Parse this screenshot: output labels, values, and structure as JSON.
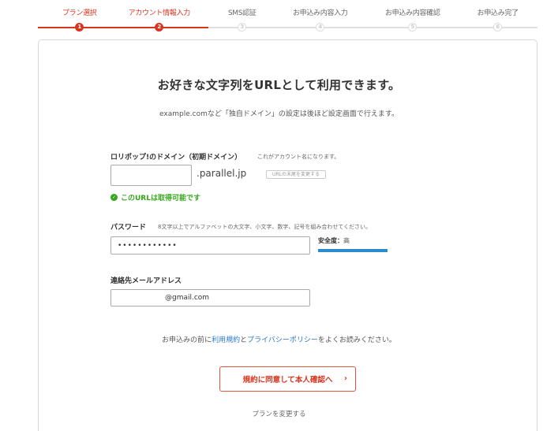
{
  "steps": [
    {
      "label": "プラン選択",
      "num": "1",
      "state": "active"
    },
    {
      "label": "アカウント情報入力",
      "num": "2",
      "state": "active"
    },
    {
      "label": "SMS認証",
      "num": "3",
      "state": "inactive"
    },
    {
      "label": "お申込み内容入力",
      "num": "4",
      "state": "inactive"
    },
    {
      "label": "お申込み内容確認",
      "num": "5",
      "state": "inactive"
    },
    {
      "label": "お申込み完了",
      "num": "6",
      "state": "inactive"
    }
  ],
  "headline": "お好きな文字列をURLとして利用できます。",
  "subline": "example.comなど「独自ドメイン」の設定は後ほど設定画面で行えます。",
  "domain": {
    "label": "ロリポップ!のドメイン（初期ドメイン）",
    "note": "これがアカウント名になります。",
    "value": "",
    "suffix": ".parallel.jp",
    "change_button": "URLの末尾を変更する",
    "availability_msg": "このURLは取得可能です"
  },
  "password": {
    "label": "パスワード",
    "note": "8文字以上でアルファベットの大文字、小文字、数字、記号を組み合わせてください。",
    "value": "••••••••••••",
    "strength_label": "安全度：",
    "strength_level": "高",
    "strength_fraction": 1.0
  },
  "email": {
    "label": "連絡先メールアドレス",
    "value": "@gmail.com"
  },
  "terms": {
    "prefix": "お申込みの前に",
    "link1": "利用規約",
    "middle": "と",
    "link2": "プライバシーポリシー",
    "suffix": "をよくお読みください。"
  },
  "submit_label": "規約に同意して本人確認へ",
  "change_plan_label": "プランを変更する",
  "colors": {
    "accent": "#d9341e",
    "success": "#36a71c",
    "link": "#2a78c8",
    "strength": "#2a8ccf"
  }
}
